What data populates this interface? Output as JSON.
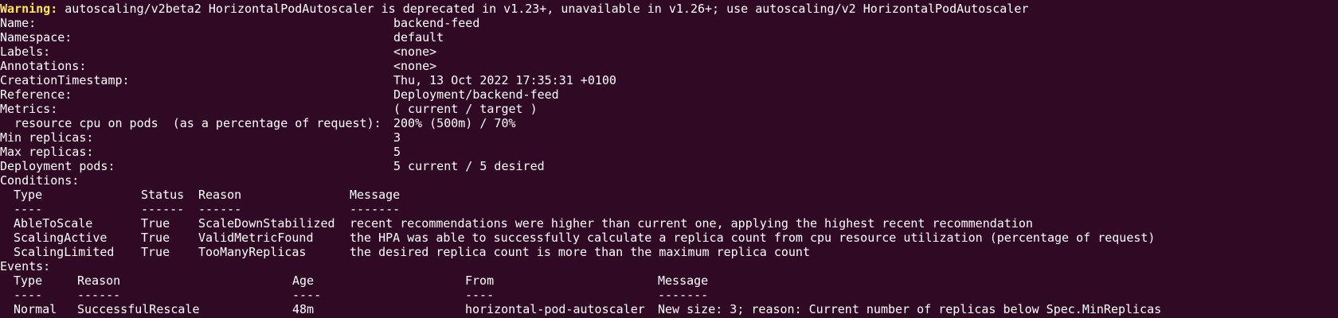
{
  "warning": {
    "prefix": "Warning:",
    "text": " autoscaling/v2beta2 HorizontalPodAutoscaler is deprecated in v1.23+, unavailable in v1.26+; use autoscaling/v2 HorizontalPodAutoscaler"
  },
  "fields": [
    {
      "key": "Name:",
      "value": "backend-feed"
    },
    {
      "key": "Namespace:",
      "value": "default"
    },
    {
      "key": "Labels:",
      "value": "<none>"
    },
    {
      "key": "Annotations:",
      "value": "<none>"
    },
    {
      "key": "CreationTimestamp:",
      "value": "Thu, 13 Oct 2022 17:35:31 +0100"
    },
    {
      "key": "Reference:",
      "value": "Deployment/backend-feed"
    },
    {
      "key": "Metrics:",
      "value": "( current / target )"
    },
    {
      "key": "  resource cpu on pods  (as a percentage of request):",
      "value": "200% (500m) / 70%"
    },
    {
      "key": "Min replicas:",
      "value": "3"
    },
    {
      "key": "Max replicas:",
      "value": "5"
    },
    {
      "key": "Deployment pods:",
      "value": "5 current / 5 desired"
    }
  ],
  "conditions": {
    "title": "Conditions:",
    "headers": [
      "Type",
      "Status",
      "Reason",
      "Message"
    ],
    "separators": [
      "----",
      "------",
      "------",
      "-------"
    ],
    "rows": [
      [
        "AbleToScale",
        "True",
        "ScaleDownStabilized",
        "recent recommendations were higher than current one, applying the highest recent recommendation"
      ],
      [
        "ScalingActive",
        "True",
        "ValidMetricFound",
        "the HPA was able to successfully calculate a replica count from cpu resource utilization (percentage of request)"
      ],
      [
        "ScalingLimited",
        "True",
        "TooManyReplicas",
        "the desired replica count is more than the maximum replica count"
      ]
    ]
  },
  "events": {
    "title": "Events:",
    "headers": [
      "Type",
      "Reason",
      "Age",
      "From",
      "Message"
    ],
    "separators": [
      "----",
      "------",
      "----",
      "----",
      "-------"
    ],
    "rows": [
      [
        "Normal",
        "SuccessfulRescale",
        "48m",
        "horizontal-pod-autoscaler",
        "New size: 3; reason: Current number of replicas below Spec.MinReplicas"
      ]
    ]
  },
  "colors": {
    "background": "#300a24",
    "foreground": "#ffffff",
    "warning": "#ffe84d"
  }
}
